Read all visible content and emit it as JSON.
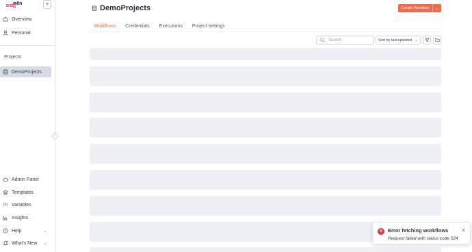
{
  "app": {
    "logo_text": "n8n",
    "add_label": "+"
  },
  "sidebar": {
    "top_items": [
      {
        "label": "Overview",
        "icon": "home-icon"
      },
      {
        "label": "Personal",
        "icon": "user-icon"
      }
    ],
    "projects_label": "Projects",
    "project_items": [
      {
        "label": "DemoProjects",
        "icon": "database-icon",
        "active": true
      }
    ],
    "bottom_items": [
      {
        "label": "Admin Panel",
        "icon": "cloud-icon"
      },
      {
        "label": "Templates",
        "icon": "layers-icon"
      },
      {
        "label": "Variables",
        "icon": "variables-icon"
      },
      {
        "label": "Insights",
        "icon": "chart-icon"
      },
      {
        "label": "Help",
        "icon": "help-icon"
      },
      {
        "label": "What's New",
        "icon": "bell-icon"
      }
    ]
  },
  "header": {
    "title": "DemoProjects",
    "create_button": "Create Workflow"
  },
  "tabs": [
    {
      "label": "Workflows",
      "active": true
    },
    {
      "label": "Credentials",
      "active": false
    },
    {
      "label": "Executions",
      "active": false
    },
    {
      "label": "Project settings",
      "active": false
    }
  ],
  "toolbar": {
    "search_placeholder": "Search",
    "sort_value": "Sort by last updated"
  },
  "toast": {
    "title": "Error fetching workflows",
    "message": "Request failed with status code 524"
  },
  "colors": {
    "accent": "#ef6b4d",
    "error": "#e03b3b",
    "skeleton": "#eef0f6"
  }
}
